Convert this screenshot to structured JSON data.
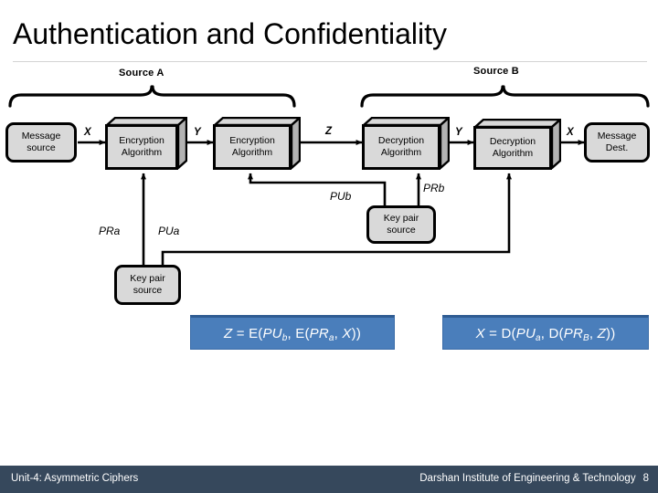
{
  "slide": {
    "title": "Authentication and Confidentiality"
  },
  "groups": {
    "source_a": "Source A",
    "source_b": "Source B"
  },
  "nodes": {
    "message_source": {
      "line1": "Message",
      "line2": "source"
    },
    "encryption_1": {
      "line1": "Encryption",
      "line2": "Algorithm"
    },
    "encryption_2": {
      "line1": "Encryption",
      "line2": "Algorithm"
    },
    "decryption_1": {
      "line1": "Decryption",
      "line2": "Algorithm"
    },
    "decryption_2": {
      "line1": "Decryption",
      "line2": "Algorithm"
    },
    "message_dest": {
      "line1": "Message",
      "line2": "Dest."
    },
    "key_pair_source_b": {
      "line1": "Key pair",
      "line2": "source"
    },
    "key_pair_source_a": {
      "line1": "Key pair",
      "line2": "source"
    }
  },
  "edge_labels": {
    "x_in": "X",
    "y_mid_left": "Y",
    "z": "Z",
    "y_mid_right": "Y",
    "x_out": "X"
  },
  "key_labels": {
    "pra": "PRa",
    "pua": "PUa",
    "pub": "PUb",
    "prb": "PRb"
  },
  "formulas": {
    "left": {
      "lhs": "Z",
      "eq": " = ",
      "fn": "E(",
      "arg1": "PU",
      "arg1_sub": "b",
      "sep1": ", ",
      "fn2": "E(",
      "arg2": "PR",
      "arg2_sub": "a",
      "sep2": ", ",
      "arg3": "X",
      "close": "))",
      "full": "Z = E(PUb, E(PRa, X))"
    },
    "right": {
      "lhs": "X",
      "eq": " = ",
      "fn": "D(",
      "arg1": "PU",
      "arg1_sub": "a",
      "sep1": ", ",
      "fn2": "D(",
      "arg2": "PR",
      "arg2_sub": "B",
      "sep2": ", ",
      "arg3": "Z",
      "close": "))",
      "full": "X = D(PUa, D(PRB, Z))"
    }
  },
  "footer": {
    "left": "Unit-4: Asymmetric Ciphers",
    "right": "Darshan Institute of Engineering & Technology",
    "page": "8"
  },
  "colors": {
    "node_fill": "#d9d9d9",
    "node_stroke": "#000000",
    "formula_fill": "#4a7ebb",
    "formula_top_border": "#2f5c92",
    "footer_bar": "#36485c",
    "title_rule": "#d4d4d4"
  }
}
